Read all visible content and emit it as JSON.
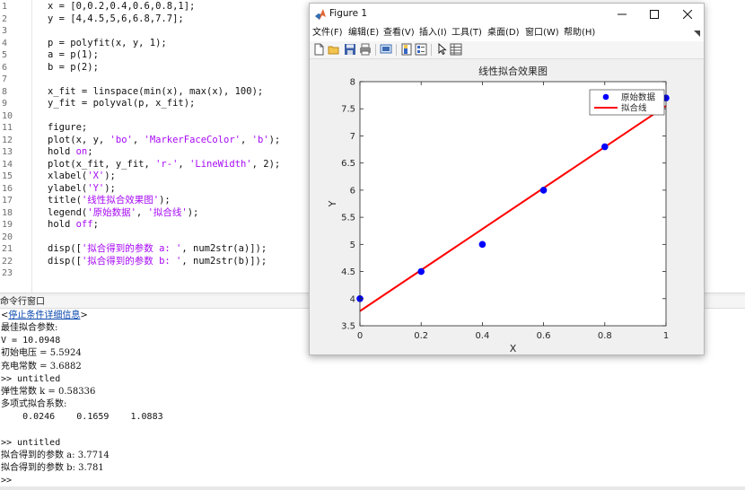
{
  "editor": {
    "lines": [
      {
        "n": "1",
        "tokens": [
          {
            "t": "x = [0,0.2,0.4,0.6,0.8,1];",
            "c": ""
          }
        ]
      },
      {
        "n": "2",
        "tokens": [
          {
            "t": "y = [4,4.5,5,6,6.8,7.7];",
            "c": ""
          }
        ]
      },
      {
        "n": "3",
        "tokens": []
      },
      {
        "n": "4",
        "tokens": [
          {
            "t": "p = polyfit(x, y, 1);",
            "c": ""
          }
        ]
      },
      {
        "n": "5",
        "tokens": [
          {
            "t": "a = p(1);",
            "c": ""
          }
        ]
      },
      {
        "n": "6",
        "tokens": [
          {
            "t": "b = p(2);",
            "c": ""
          }
        ]
      },
      {
        "n": "7",
        "tokens": []
      },
      {
        "n": "8",
        "tokens": [
          {
            "t": "x_fit = linspace(min(x), max(x), 100);",
            "c": ""
          }
        ]
      },
      {
        "n": "9",
        "tokens": [
          {
            "t": "y_fit = polyval(p, x_fit);",
            "c": ""
          }
        ]
      },
      {
        "n": "10",
        "tokens": []
      },
      {
        "n": "11",
        "tokens": [
          {
            "t": "figure;",
            "c": ""
          }
        ]
      },
      {
        "n": "12",
        "tokens": [
          {
            "t": "plot(x, y, ",
            "c": ""
          },
          {
            "t": "'bo'",
            "c": "str"
          },
          {
            "t": ", ",
            "c": ""
          },
          {
            "t": "'MarkerFaceColor'",
            "c": "str"
          },
          {
            "t": ", ",
            "c": ""
          },
          {
            "t": "'b'",
            "c": "str"
          },
          {
            "t": ");",
            "c": ""
          }
        ]
      },
      {
        "n": "13",
        "tokens": [
          {
            "t": "hold ",
            "c": ""
          },
          {
            "t": "on",
            "c": "str"
          },
          {
            "t": ";",
            "c": ""
          }
        ]
      },
      {
        "n": "14",
        "tokens": [
          {
            "t": "plot(x_fit, y_fit, ",
            "c": ""
          },
          {
            "t": "'r-'",
            "c": "str"
          },
          {
            "t": ", ",
            "c": ""
          },
          {
            "t": "'LineWidth'",
            "c": "str"
          },
          {
            "t": ", 2);",
            "c": ""
          }
        ]
      },
      {
        "n": "15",
        "tokens": [
          {
            "t": "xlabel(",
            "c": ""
          },
          {
            "t": "'X'",
            "c": "str"
          },
          {
            "t": ");",
            "c": ""
          }
        ]
      },
      {
        "n": "16",
        "tokens": [
          {
            "t": "ylabel(",
            "c": ""
          },
          {
            "t": "'Y'",
            "c": "str"
          },
          {
            "t": ");",
            "c": ""
          }
        ]
      },
      {
        "n": "17",
        "tokens": [
          {
            "t": "title(",
            "c": ""
          },
          {
            "t": "'线性拟合效果图'",
            "c": "str"
          },
          {
            "t": ");",
            "c": ""
          }
        ]
      },
      {
        "n": "18",
        "tokens": [
          {
            "t": "legend(",
            "c": ""
          },
          {
            "t": "'原始数据'",
            "c": "str"
          },
          {
            "t": ", ",
            "c": ""
          },
          {
            "t": "'拟合线'",
            "c": "str"
          },
          {
            "t": ");",
            "c": ""
          }
        ]
      },
      {
        "n": "19",
        "tokens": [
          {
            "t": "hold ",
            "c": ""
          },
          {
            "t": "off",
            "c": "str"
          },
          {
            "t": ";",
            "c": ""
          }
        ]
      },
      {
        "n": "20",
        "tokens": []
      },
      {
        "n": "21",
        "tokens": [
          {
            "t": "disp([",
            "c": ""
          },
          {
            "t": "'拟合得到的参数 a: '",
            "c": "str"
          },
          {
            "t": ", num2str(a)]);",
            "c": ""
          }
        ]
      },
      {
        "n": "22",
        "tokens": [
          {
            "t": "disp([",
            "c": ""
          },
          {
            "t": "'拟合得到的参数 b: '",
            "c": "str"
          },
          {
            "t": ", num2str(b)]);",
            "c": ""
          }
        ]
      },
      {
        "n": "23",
        "tokens": []
      }
    ]
  },
  "command_window": {
    "title": "命令行窗口",
    "link_prefix": "<",
    "link_text": "停止条件详细信息",
    "link_suffix": ">",
    "lines": [
      "最佳拟合参数:",
      "V = 10.0948",
      "初始电压 = 5.5924",
      "充电常数 = 3.6882",
      ">> untitled",
      "弹性常数 k = 0.58336",
      "多项式拟合系数:",
      "    0.0246    0.1659    1.0883",
      "",
      ">> untitled",
      "拟合得到的参数 a: 3.7714",
      "拟合得到的参数 b: 3.781",
      ">>"
    ]
  },
  "figure": {
    "window_title": "Figure 1",
    "menu": [
      "文件(F)",
      "编辑(E)",
      "查看(V)",
      "插入(I)",
      "工具(T)",
      "桌面(D)",
      "窗口(W)",
      "帮助(H)"
    ],
    "toolbar_icons": [
      "new-figure-icon",
      "open-file-icon",
      "save-icon",
      "print-icon",
      "link-plot-icon",
      "colorbar-icon",
      "legend-icon",
      "pointer-icon",
      "property-inspector-icon"
    ]
  },
  "colors": {
    "marker": "#0000ff",
    "fit_line": "#ff0000",
    "string": "#a709f5",
    "link": "#0645ad"
  },
  "chart_data": {
    "type": "scatter",
    "title": "线性拟合效果图",
    "xlabel": "X",
    "ylabel": "Y",
    "xlim": [
      0,
      1
    ],
    "ylim": [
      3.5,
      8
    ],
    "xticks": [
      "0",
      "0.2",
      "0.4",
      "0.6",
      "0.8",
      "1"
    ],
    "yticks": [
      "3.5",
      "4",
      "4.5",
      "5",
      "5.5",
      "6",
      "6.5",
      "7",
      "7.5",
      "8"
    ],
    "legend_position": "top-right",
    "series": [
      {
        "name": "原始数据",
        "kind": "markers",
        "x": [
          0,
          0.2,
          0.4,
          0.6,
          0.8,
          1
        ],
        "y": [
          4,
          4.5,
          5,
          6,
          6.8,
          7.7
        ]
      },
      {
        "name": "拟合线",
        "kind": "line",
        "x": [
          0,
          1
        ],
        "y": [
          3.771,
          7.552
        ]
      }
    ]
  }
}
